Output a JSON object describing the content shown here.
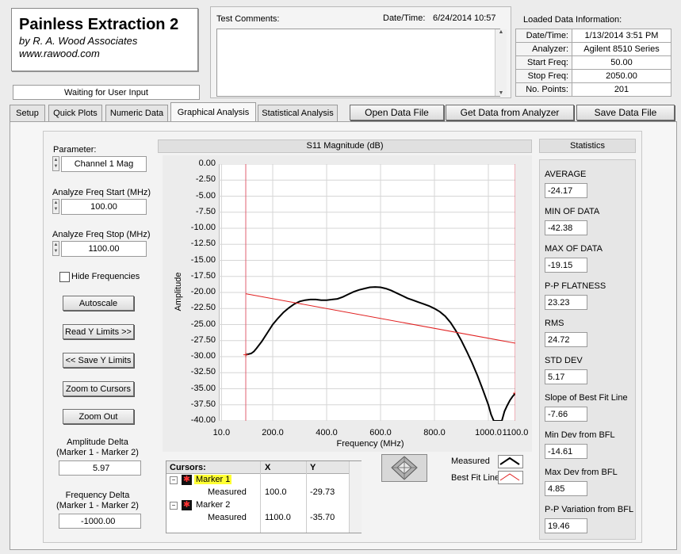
{
  "app": {
    "title": "Painless Extraction 2",
    "author": "by R. A. Wood Associates",
    "website": "www.rawood.com",
    "status": "Waiting for User Input"
  },
  "test_comments": {
    "label": "Test Comments:",
    "value": ""
  },
  "datetime": {
    "label": "Date/Time:",
    "value": "6/24/2014  10:57"
  },
  "loaded_info": {
    "title": "Loaded Data Information:",
    "rows": [
      {
        "label": "Date/Time:",
        "value": "1/13/2014 3:51 PM"
      },
      {
        "label": "Analyzer:",
        "value": "Agilent 8510 Series"
      },
      {
        "label": "Start Freq:",
        "value": "50.00"
      },
      {
        "label": "Stop Freq:",
        "value": "2050.00"
      },
      {
        "label": "No. Points:",
        "value": "201"
      }
    ]
  },
  "tabs": [
    "Setup",
    "Quick Plots",
    "Numeric Data",
    "Graphical Analysis",
    "Statistical Analysis"
  ],
  "toolbar": {
    "open": "Open Data File",
    "get": "Get Data from Analyzer",
    "save": "Save Data File"
  },
  "left": {
    "parameter_label": "Parameter:",
    "parameter_value": "Channel 1 Mag",
    "freq_start_label": "Analyze Freq Start (MHz)",
    "freq_start_value": "100.00",
    "freq_stop_label": "Analyze Freq Stop (MHz)",
    "freq_stop_value": "1100.00",
    "hide_freq_label": "Hide Frequencies",
    "autoscale": "Autoscale",
    "read_y": "Read Y Limits >>",
    "save_y": "<< Save Y Limits",
    "zoom_cursors": "Zoom to Cursors",
    "zoom_out": "Zoom Out",
    "amp_delta_label1": "Amplitude Delta",
    "amp_delta_label2": "(Marker 1 - Marker 2)",
    "amp_delta_value": "5.97",
    "freq_delta_label1": "Frequency Delta",
    "freq_delta_label2": "(Marker 1 - Marker 2)",
    "freq_delta_value": "-1000.00"
  },
  "cursors": {
    "header": [
      "Cursors:",
      "X",
      "Y"
    ],
    "marker1": "Marker 1",
    "marker1_sub": "Measured",
    "marker1_x": "100.0",
    "marker1_y": "-29.73",
    "marker2": "Marker 2",
    "marker2_sub": "Measured",
    "marker2_x": "1100.0",
    "marker2_y": "-35.70"
  },
  "legend": {
    "measured": "Measured",
    "bestfit": "Best Fit Line"
  },
  "statistics": {
    "title": "Statistics",
    "items": [
      {
        "label": "AVERAGE",
        "value": "-24.17"
      },
      {
        "label": "MIN OF DATA",
        "value": "-42.38"
      },
      {
        "label": "MAX OF DATA",
        "value": "-19.15"
      },
      {
        "label": "P-P FLATNESS",
        "value": "23.23"
      },
      {
        "label": "RMS",
        "value": "24.72"
      },
      {
        "label": "STD DEV",
        "value": "5.17"
      },
      {
        "label": "Slope of Best Fit Line",
        "value": "-7.66"
      },
      {
        "label": "Min Dev from BFL",
        "value": "-14.61"
      },
      {
        "label": "Max Dev from BFL",
        "value": "4.85"
      },
      {
        "label": "P-P Variation from BFL",
        "value": "19.46"
      }
    ]
  },
  "colors": {
    "measured": "#000000",
    "bestfit": "#e02020",
    "cursor": "#e06070",
    "highlight": "#ffff33"
  },
  "chart_data": {
    "type": "line",
    "title": "S11 Magnitude (dB)",
    "xlabel": "Frequency (MHz)",
    "ylabel": "Amplitude",
    "xlim": [
      0,
      1100
    ],
    "ylim": [
      -40,
      0
    ],
    "x_ticks": [
      "10.0",
      "200.0",
      "400.0",
      "600.0",
      "800.0",
      "1000.0",
      "1100.0"
    ],
    "y_ticks": [
      "0.00",
      "-2.50",
      "-5.00",
      "-7.50",
      "-10.00",
      "-12.50",
      "-15.00",
      "-17.50",
      "-20.00",
      "-22.50",
      "-25.00",
      "-27.50",
      "-30.00",
      "-32.50",
      "-35.00",
      "-37.50",
      "-40.00"
    ],
    "grid": true,
    "cursors_x": [
      100,
      1100
    ],
    "series": [
      {
        "name": "Measured",
        "x": [
          100,
          110,
          120,
          130,
          140,
          160,
          180,
          200,
          220,
          240,
          260,
          280,
          300,
          320,
          340,
          360,
          380,
          400,
          420,
          440,
          460,
          480,
          500,
          520,
          540,
          560,
          580,
          600,
          620,
          640,
          660,
          680,
          700,
          720,
          740,
          760,
          780,
          800,
          820,
          840,
          860,
          880,
          900,
          920,
          940,
          960,
          980,
          1000,
          1010,
          1020,
          1030,
          1040,
          1050,
          1060,
          1070,
          1080,
          1090,
          1100
        ],
        "y": [
          -29.7,
          -29.6,
          -29.5,
          -29.2,
          -28.7,
          -27.6,
          -26.3,
          -25.0,
          -24.0,
          -23.1,
          -22.4,
          -21.8,
          -21.4,
          -21.2,
          -21.1,
          -21.1,
          -21.2,
          -21.2,
          -21.1,
          -21.0,
          -20.7,
          -20.3,
          -19.9,
          -19.6,
          -19.4,
          -19.2,
          -19.15,
          -19.2,
          -19.4,
          -19.7,
          -20.1,
          -20.5,
          -20.9,
          -21.2,
          -21.5,
          -21.8,
          -22.1,
          -22.5,
          -23.0,
          -23.7,
          -24.7,
          -26.0,
          -27.5,
          -29.2,
          -31.0,
          -33.0,
          -35.2,
          -37.5,
          -39.0,
          -40.5,
          -42.38,
          -41.5,
          -40.0,
          -38.5,
          -37.6,
          -36.8,
          -36.2,
          -35.7
        ]
      },
      {
        "name": "Best Fit Line",
        "x": [
          100,
          1100
        ],
        "y": [
          -20.2,
          -27.9
        ]
      }
    ]
  }
}
